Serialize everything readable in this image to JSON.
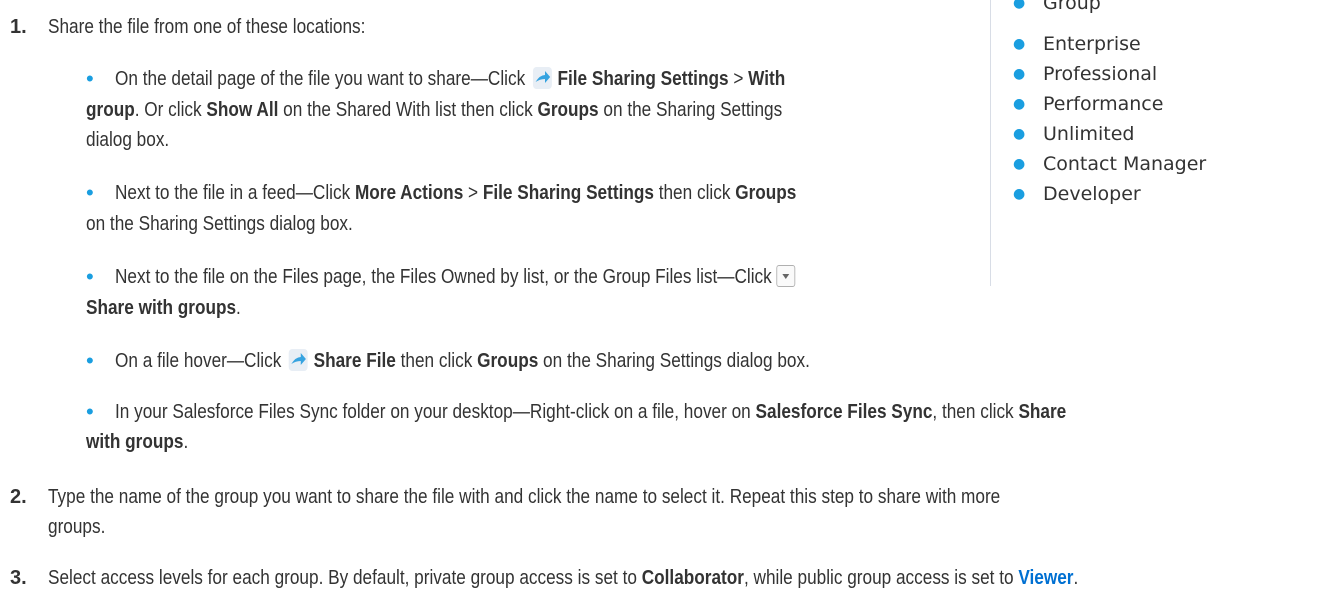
{
  "sidebar": {
    "editions": [
      "Group",
      "Enterprise",
      "Professional",
      "Performance",
      "Unlimited",
      "Contact Manager",
      "Developer"
    ]
  },
  "steps": [
    {
      "number": "1.",
      "text": "Share the file from one of these locations:",
      "bullets": [
        {
          "lines": [
            [
              "On the detail page of the file you want to share—Click ",
              "[share-icon]",
              "File Sharing Settings",
              " > ",
              "With"
            ],
            [
              "group",
              ". Or click ",
              "Show All",
              " on the Shared With list then click ",
              "Groups",
              " on the Sharing Settings"
            ],
            [
              "dialog box."
            ]
          ]
        },
        {
          "lines": [
            [
              "Next to the file in a feed—Click ",
              "More Actions",
              " > ",
              "File Sharing Settings",
              " then click ",
              "Groups"
            ],
            [
              "on the Sharing Settings dialog box."
            ]
          ]
        },
        {
          "lines": [
            [
              "Next to the file on the Files page, the Files Owned by list, or the Group Files list—Click ",
              "[dropdown-icon]"
            ],
            [
              "Share with groups",
              "."
            ]
          ]
        },
        {
          "lines": [
            [
              "On a file hover—Click ",
              "[share-icon]",
              "Share File",
              " then click ",
              "Groups",
              " on the Sharing Settings dialog box."
            ]
          ]
        },
        {
          "lines": [
            [
              "In your Salesforce Files Sync folder on your desktop—Right-click on a file, hover on ",
              "Salesforce Files Sync",
              ", then click ",
              "Share"
            ],
            [
              "with groups",
              "."
            ]
          ]
        }
      ]
    },
    {
      "number": "2.",
      "lines": [
        "Type the name of the group you want to share the file with and click the name to select it. Repeat this step to share with more",
        "groups."
      ]
    },
    {
      "number": "3.",
      "lines": [
        [
          "Select access levels for each group. By default, private group access is set to ",
          "Collaborator",
          ", while public group access is set to ",
          "Viewer",
          "."
        ]
      ]
    }
  ],
  "icons": {
    "share": "share-file-icon",
    "dropdown": "dropdown-menu-icon"
  },
  "colors": {
    "bullet": "#1a9ee0",
    "link": "#0070d2",
    "text": "#333333"
  }
}
